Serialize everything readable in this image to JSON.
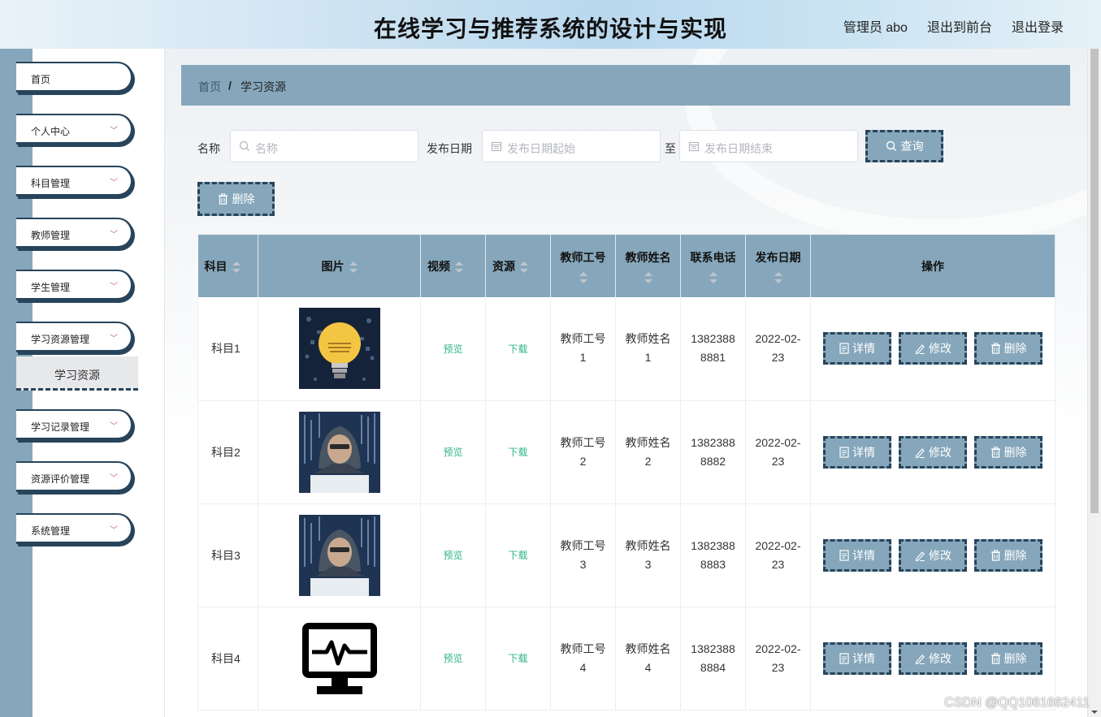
{
  "header": {
    "title": "在线学习与推荐系统的设计与实现",
    "user_label": "管理员 abo",
    "to_front_label": "退出到前台",
    "logout_label": "退出登录"
  },
  "sidebar": {
    "items": [
      {
        "label": "首页",
        "has_chevron": false
      },
      {
        "label": "个人中心",
        "has_chevron": true
      },
      {
        "label": "科目管理",
        "has_chevron": true
      },
      {
        "label": "教师管理",
        "has_chevron": true
      },
      {
        "label": "学生管理",
        "has_chevron": true
      },
      {
        "label": "学习资源管理",
        "has_chevron": true
      },
      {
        "label": "学习记录管理",
        "has_chevron": true
      },
      {
        "label": "资源评价管理",
        "has_chevron": true
      },
      {
        "label": "系统管理",
        "has_chevron": true
      }
    ],
    "active_sub_item": "学习资源"
  },
  "breadcrumb": {
    "home": "首页",
    "separator": "/",
    "current": "学习资源"
  },
  "search": {
    "name_label": "名称",
    "name_placeholder": "名称",
    "date_label": "发布日期",
    "date_start_placeholder": "发布日期起始",
    "to_label": "至",
    "date_end_placeholder": "发布日期结束",
    "query_button": "查询",
    "delete_button": "删除"
  },
  "table": {
    "columns": [
      "科目",
      "图片",
      "视频",
      "资源",
      "教师工号",
      "教师姓名",
      "联系电话",
      "发布日期",
      "操作"
    ],
    "preview_label": "预览",
    "download_label": "下载",
    "detail_button": "详情",
    "edit_button": "修改",
    "delete_button": "删除",
    "rows": [
      {
        "subject": "科目1",
        "image": "idea-bulb-image",
        "teacher_id": "教师工号1",
        "teacher_name": "教师姓名1",
        "phone": "13823888881",
        "date": "2022-02-23"
      },
      {
        "subject": "科目2",
        "image": "hacker-image",
        "teacher_id": "教师工号2",
        "teacher_name": "教师姓名2",
        "phone": "13823888882",
        "date": "2022-02-23"
      },
      {
        "subject": "科目3",
        "image": "hacker-image",
        "teacher_id": "教师工号3",
        "teacher_name": "教师姓名3",
        "phone": "13823888883",
        "date": "2022-02-23"
      },
      {
        "subject": "科目4",
        "image": "monitor-heartbeat-icon",
        "teacher_id": "教师工号4",
        "teacher_name": "教师姓名4",
        "phone": "13823888884",
        "date": "2022-02-23"
      }
    ]
  },
  "watermark": "CSDN @QQ1061662411",
  "colors": {
    "accent": "#86a7bb",
    "border_dark": "#27445b",
    "link": "#2fb38a"
  }
}
